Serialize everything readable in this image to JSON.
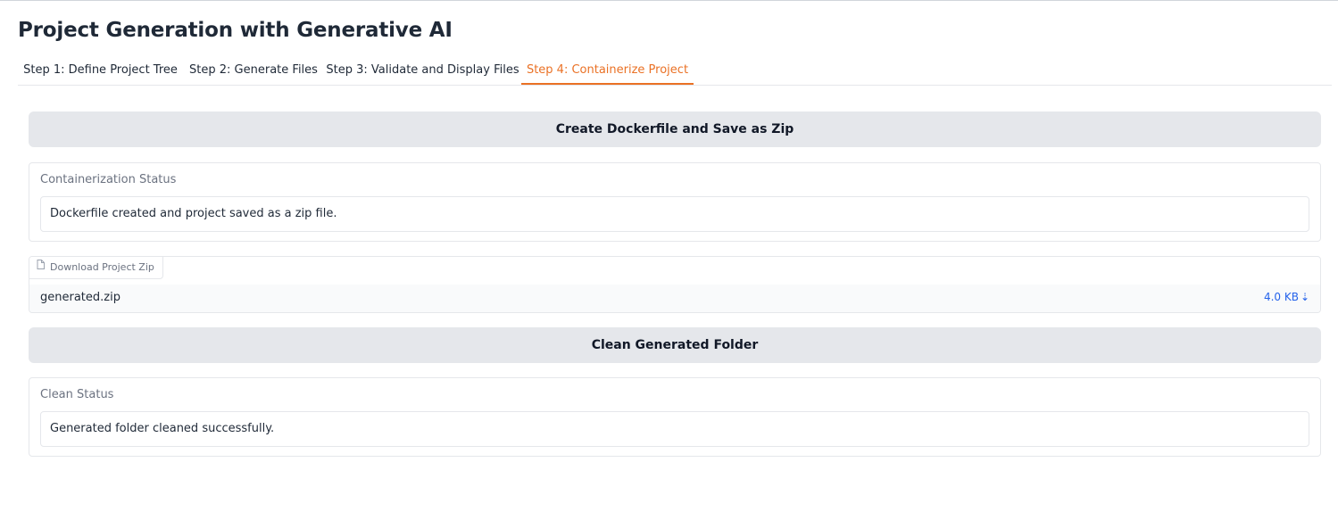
{
  "page": {
    "title": "Project Generation with Generative AI"
  },
  "tabs": [
    {
      "label": "Step 1: Define Project Tree",
      "active": false
    },
    {
      "label": "Step 2: Generate Files",
      "active": false
    },
    {
      "label": "Step 3: Validate and Display Files",
      "active": false
    },
    {
      "label": "Step 4: Containerize Project",
      "active": true
    }
  ],
  "containerize": {
    "button_label": "Create Dockerfile and Save as Zip",
    "status_label": "Containerization Status",
    "status_value": "Dockerfile created and project saved as a zip file."
  },
  "download": {
    "label": "Download Project Zip",
    "label_icon": "file-icon",
    "file_name": "generated.zip",
    "file_size": "4.0 KB",
    "download_icon": "download-arrow-icon"
  },
  "clean": {
    "button_label": "Clean Generated Folder",
    "status_label": "Clean Status",
    "status_value": "Generated folder cleaned successfully."
  },
  "colors": {
    "accent": "#ea7125",
    "link": "#2563eb",
    "button_bg": "#e5e7eb"
  }
}
